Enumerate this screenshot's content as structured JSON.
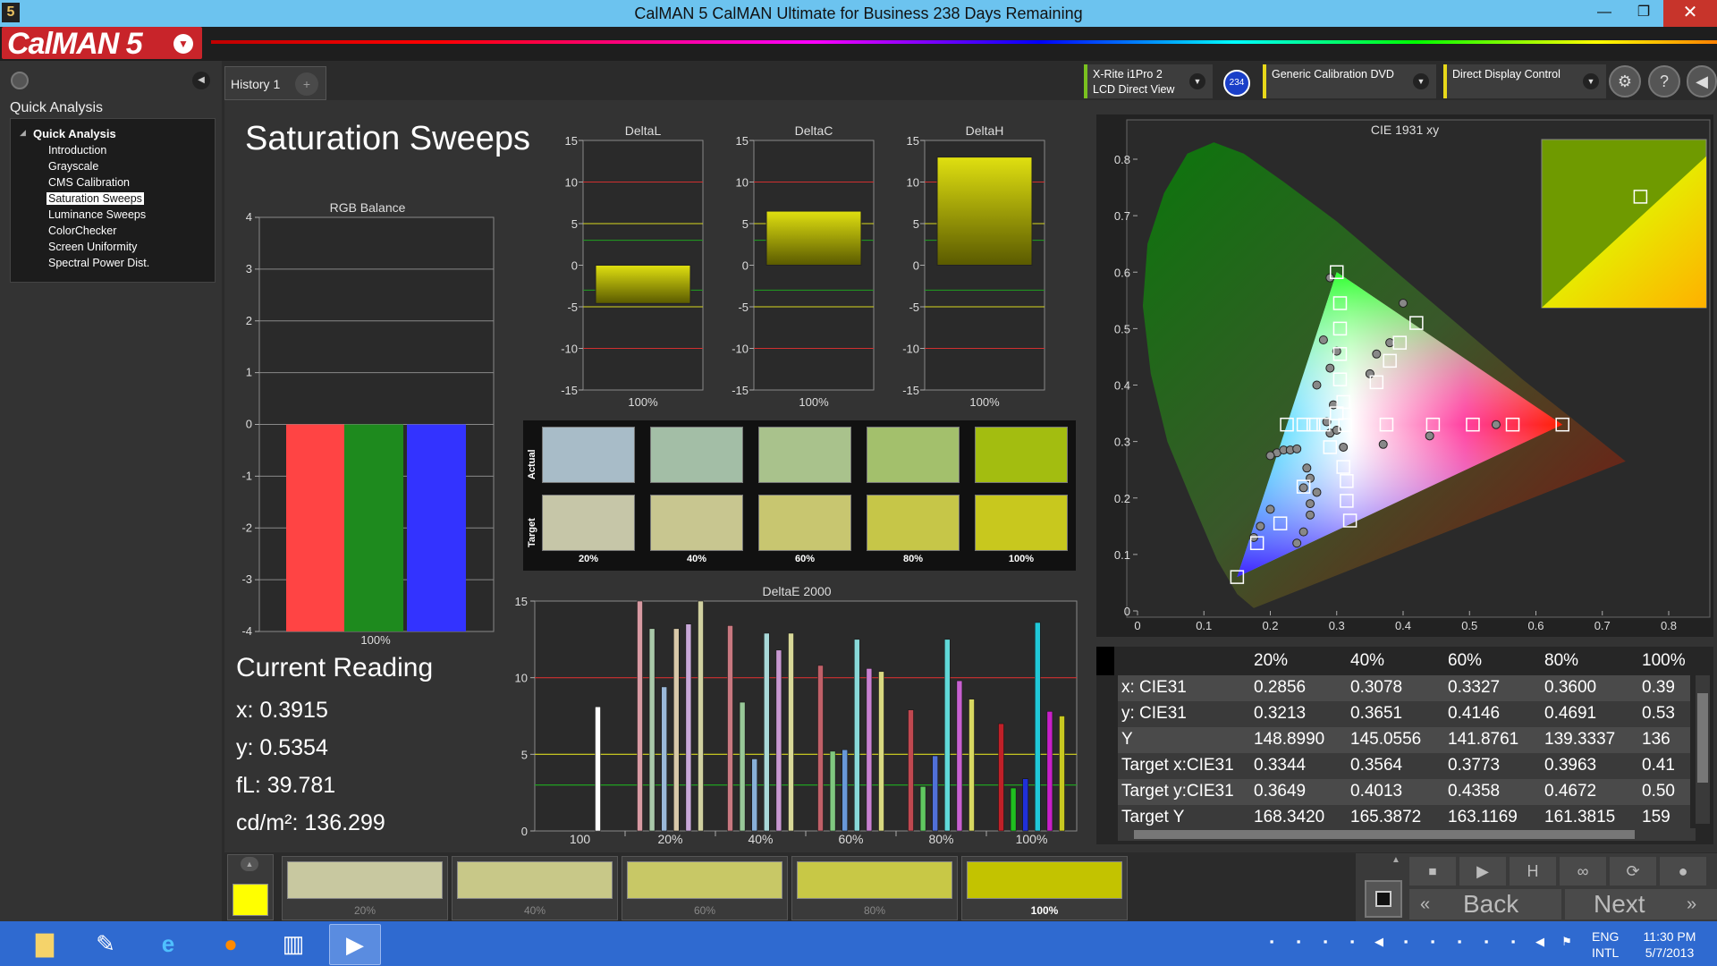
{
  "window": {
    "title": "CalMAN 5 CalMAN Ultimate for Business 238 Days Remaining",
    "app_icon": "5"
  },
  "logo": {
    "text": "CalMAN 5"
  },
  "sidebar": {
    "title": "Quick Analysis",
    "root": "Quick Analysis",
    "items": [
      "Introduction",
      "Grayscale",
      "CMS Calibration",
      "Saturation Sweeps",
      "Luminance Sweeps",
      "ColorChecker",
      "Screen Uniformity",
      "Spectral Power Dist."
    ],
    "selected": "Saturation Sweeps"
  },
  "tab": {
    "label": "History 1",
    "plus": "+"
  },
  "devices": {
    "meter_line1": "X-Rite i1Pro 2",
    "meter_line2": "LCD Direct View",
    "meter_badge": "234",
    "source": "Generic Calibration DVD",
    "display": "Direct Display Control"
  },
  "page_title": "Saturation Sweeps",
  "rgb_balance": {
    "title": "RGB Balance",
    "xlabel": "100%",
    "ylim": [
      -4,
      4
    ],
    "ticks": [
      "4",
      "3",
      "2",
      "1",
      "0",
      "-1",
      "-2",
      "-3",
      "-4"
    ],
    "values": {
      "red": -4.0,
      "green": -4.0,
      "blue": -4.0
    },
    "colors": {
      "red": "#ff4444",
      "green": "#1e8a1e",
      "blue": "#3333ff"
    }
  },
  "delta_charts": [
    {
      "title": "DeltaL",
      "xlabel": "100%",
      "value": -4.6
    },
    {
      "title": "DeltaC",
      "xlabel": "100%",
      "value": 6.5
    },
    {
      "title": "DeltaH",
      "xlabel": "100%",
      "value": 13.0
    }
  ],
  "delta_ticks": [
    "15",
    "10",
    "5",
    "0",
    "-5",
    "-10",
    "-15"
  ],
  "swatches": {
    "actual_label": "Actual",
    "target_label": "Target",
    "labels": [
      "20%",
      "40%",
      "60%",
      "80%",
      "100%"
    ],
    "actual": [
      "#a8bcc8",
      "#a3bea6",
      "#a9c28c",
      "#a3c06c",
      "#a3bd10"
    ],
    "target": [
      "#c6c6a8",
      "#c8c690",
      "#c8c670",
      "#c6c648",
      "#c8c81e"
    ]
  },
  "deltae": {
    "title": "DeltaE 2000",
    "yticks": [
      "15",
      "10",
      "5",
      "0"
    ],
    "groups": [
      "100",
      "20%",
      "40%",
      "60%",
      "80%",
      "100%"
    ]
  },
  "chart_data": {
    "type": "bar",
    "title": "DeltaE 2000",
    "categories": [
      "100",
      "20%",
      "40%",
      "60%",
      "80%",
      "100%"
    ],
    "ylim": [
      0,
      15
    ],
    "groups": [
      {
        "label": "100",
        "bars": [
          {
            "v": 8.1,
            "c": "#ffffff"
          }
        ]
      },
      {
        "label": "20%",
        "bars": [
          {
            "v": 15.0,
            "c": "#d89aa2"
          },
          {
            "v": 13.2,
            "c": "#a8c8a8"
          },
          {
            "v": 9.4,
            "c": "#9ab8d8"
          },
          {
            "v": 13.2,
            "c": "#d8c8a8"
          },
          {
            "v": 13.5,
            "c": "#c8a8d8"
          },
          {
            "v": 15.0,
            "c": "#d0d0a0"
          }
        ]
      },
      {
        "label": "40%",
        "bars": [
          {
            "v": 13.4,
            "c": "#c87880"
          },
          {
            "v": 8.4,
            "c": "#98c898"
          },
          {
            "v": 4.7,
            "c": "#88b0d8"
          },
          {
            "v": 12.9,
            "c": "#a8d8d8"
          },
          {
            "v": 11.8,
            "c": "#c898d0"
          },
          {
            "v": 12.9,
            "c": "#d8d898"
          }
        ]
      },
      {
        "label": "60%",
        "bars": [
          {
            "v": 10.8,
            "c": "#c06068"
          },
          {
            "v": 5.2,
            "c": "#80c880"
          },
          {
            "v": 5.3,
            "c": "#6898d8"
          },
          {
            "v": 12.5,
            "c": "#88d8d8"
          },
          {
            "v": 10.6,
            "c": "#c880d0"
          },
          {
            "v": 10.4,
            "c": "#d8d880"
          }
        ]
      },
      {
        "label": "80%",
        "bars": [
          {
            "v": 7.9,
            "c": "#c04850"
          },
          {
            "v": 2.9,
            "c": "#60c860"
          },
          {
            "v": 4.9,
            "c": "#5070d8"
          },
          {
            "v": 12.5,
            "c": "#60d8d8"
          },
          {
            "v": 9.8,
            "c": "#c860d0"
          },
          {
            "v": 8.6,
            "c": "#d8d860"
          }
        ]
      },
      {
        "label": "100%",
        "bars": [
          {
            "v": 7.0,
            "c": "#c02028"
          },
          {
            "v": 2.8,
            "c": "#20c020"
          },
          {
            "v": 3.4,
            "c": "#2030d8"
          },
          {
            "v": 13.6,
            "c": "#20c8d8"
          },
          {
            "v": 7.8,
            "c": "#c820c8"
          },
          {
            "v": 7.5,
            "c": "#c8c820"
          }
        ]
      }
    ],
    "reference_lines": [
      {
        "v": 10,
        "c": "#d03030"
      },
      {
        "v": 5,
        "c": "#d8d820"
      },
      {
        "v": 3,
        "c": "#20a020"
      }
    ]
  },
  "cie": {
    "title": "CIE 1931 xy",
    "xticks": [
      "0",
      "0.1",
      "0.2",
      "0.3",
      "0.4",
      "0.5",
      "0.6",
      "0.7",
      "0.8"
    ],
    "yticks": [
      "0",
      "0.1",
      "0.2",
      "0.3",
      "0.4",
      "0.5",
      "0.6",
      "0.7",
      "0.8"
    ],
    "gamut": {
      "red": [
        0.64,
        0.33
      ],
      "green": [
        0.3,
        0.6
      ],
      "blue": [
        0.15,
        0.06
      ],
      "white": [
        0.3127,
        0.329
      ]
    },
    "targets": [
      [
        0.225,
        0.33
      ],
      [
        0.25,
        0.33
      ],
      [
        0.265,
        0.33
      ],
      [
        0.28,
        0.33
      ],
      [
        0.3127,
        0.329
      ],
      [
        0.375,
        0.33
      ],
      [
        0.445,
        0.33
      ],
      [
        0.505,
        0.33
      ],
      [
        0.565,
        0.33
      ],
      [
        0.64,
        0.33
      ],
      [
        0.305,
        0.545
      ],
      [
        0.305,
        0.5
      ],
      [
        0.305,
        0.455
      ],
      [
        0.305,
        0.41
      ],
      [
        0.31,
        0.37
      ],
      [
        0.3,
        0.6
      ],
      [
        0.42,
        0.51
      ],
      [
        0.395,
        0.475
      ],
      [
        0.38,
        0.443
      ],
      [
        0.36,
        0.405
      ],
      [
        0.29,
        0.29
      ],
      [
        0.31,
        0.255
      ],
      [
        0.315,
        0.23
      ],
      [
        0.315,
        0.195
      ],
      [
        0.32,
        0.16
      ],
      [
        0.25,
        0.22
      ],
      [
        0.215,
        0.155
      ],
      [
        0.18,
        0.12
      ],
      [
        0.15,
        0.06
      ],
      [
        0.3,
        0.35
      ]
    ],
    "actuals": [
      [
        0.21,
        0.28
      ],
      [
        0.22,
        0.285
      ],
      [
        0.23,
        0.285
      ],
      [
        0.24,
        0.287
      ],
      [
        0.2,
        0.275
      ],
      [
        0.285,
        0.335
      ],
      [
        0.29,
        0.315
      ],
      [
        0.295,
        0.365
      ],
      [
        0.27,
        0.4
      ],
      [
        0.29,
        0.43
      ],
      [
        0.3,
        0.46
      ],
      [
        0.28,
        0.48
      ],
      [
        0.29,
        0.59
      ],
      [
        0.38,
        0.475
      ],
      [
        0.36,
        0.455
      ],
      [
        0.4,
        0.545
      ],
      [
        0.35,
        0.42
      ],
      [
        0.37,
        0.295
      ],
      [
        0.44,
        0.31
      ],
      [
        0.54,
        0.33
      ],
      [
        0.31,
        0.29
      ],
      [
        0.3,
        0.32
      ],
      [
        0.255,
        0.253
      ],
      [
        0.26,
        0.235
      ],
      [
        0.25,
        0.218
      ],
      [
        0.27,
        0.21
      ],
      [
        0.26,
        0.19
      ],
      [
        0.26,
        0.17
      ],
      [
        0.25,
        0.14
      ],
      [
        0.24,
        0.12
      ],
      [
        0.2,
        0.18
      ],
      [
        0.185,
        0.15
      ],
      [
        0.175,
        0.13
      ]
    ],
    "inset_point": [
      0.6,
      0.66
    ]
  },
  "reading": {
    "title": "Current Reading",
    "x": "x: 0.3915",
    "y": "y: 0.5354",
    "fl": "fL: 39.781",
    "cdm2": "cd/m²: 136.299",
    "swatch_color": "#ffff00"
  },
  "table": {
    "columns": [
      "20%",
      "40%",
      "60%",
      "80%",
      "100%"
    ],
    "rows": [
      {
        "label": "x: CIE31",
        "values": [
          "0.2856",
          "0.3078",
          "0.3327",
          "0.3600",
          "0.39"
        ]
      },
      {
        "label": "y: CIE31",
        "values": [
          "0.3213",
          "0.3651",
          "0.4146",
          "0.4691",
          "0.53"
        ]
      },
      {
        "label": "Y",
        "values": [
          "148.8990",
          "145.0556",
          "141.8761",
          "139.3337",
          "136"
        ]
      },
      {
        "label": "Target x:CIE31",
        "values": [
          "0.3344",
          "0.3564",
          "0.3773",
          "0.3963",
          "0.41"
        ]
      },
      {
        "label": "Target y:CIE31",
        "values": [
          "0.3649",
          "0.4013",
          "0.4358",
          "0.4672",
          "0.50"
        ]
      },
      {
        "label": "Target Y",
        "values": [
          "168.3420",
          "165.3872",
          "163.1169",
          "161.3815",
          "159"
        ]
      }
    ]
  },
  "bottom_swatches": [
    {
      "label": "20%",
      "color": "#c8c8a0"
    },
    {
      "label": "40%",
      "color": "#c8c888"
    },
    {
      "label": "60%",
      "color": "#c8c866"
    },
    {
      "label": "80%",
      "color": "#c8c846"
    },
    {
      "label": "100%",
      "color": "#c3c300"
    }
  ],
  "nav": {
    "back": "Back",
    "next": "Next"
  },
  "taskbar": {
    "lang1": "ENG",
    "lang2": "INTL",
    "time": "11:30 PM",
    "date": "5/7/2013"
  }
}
